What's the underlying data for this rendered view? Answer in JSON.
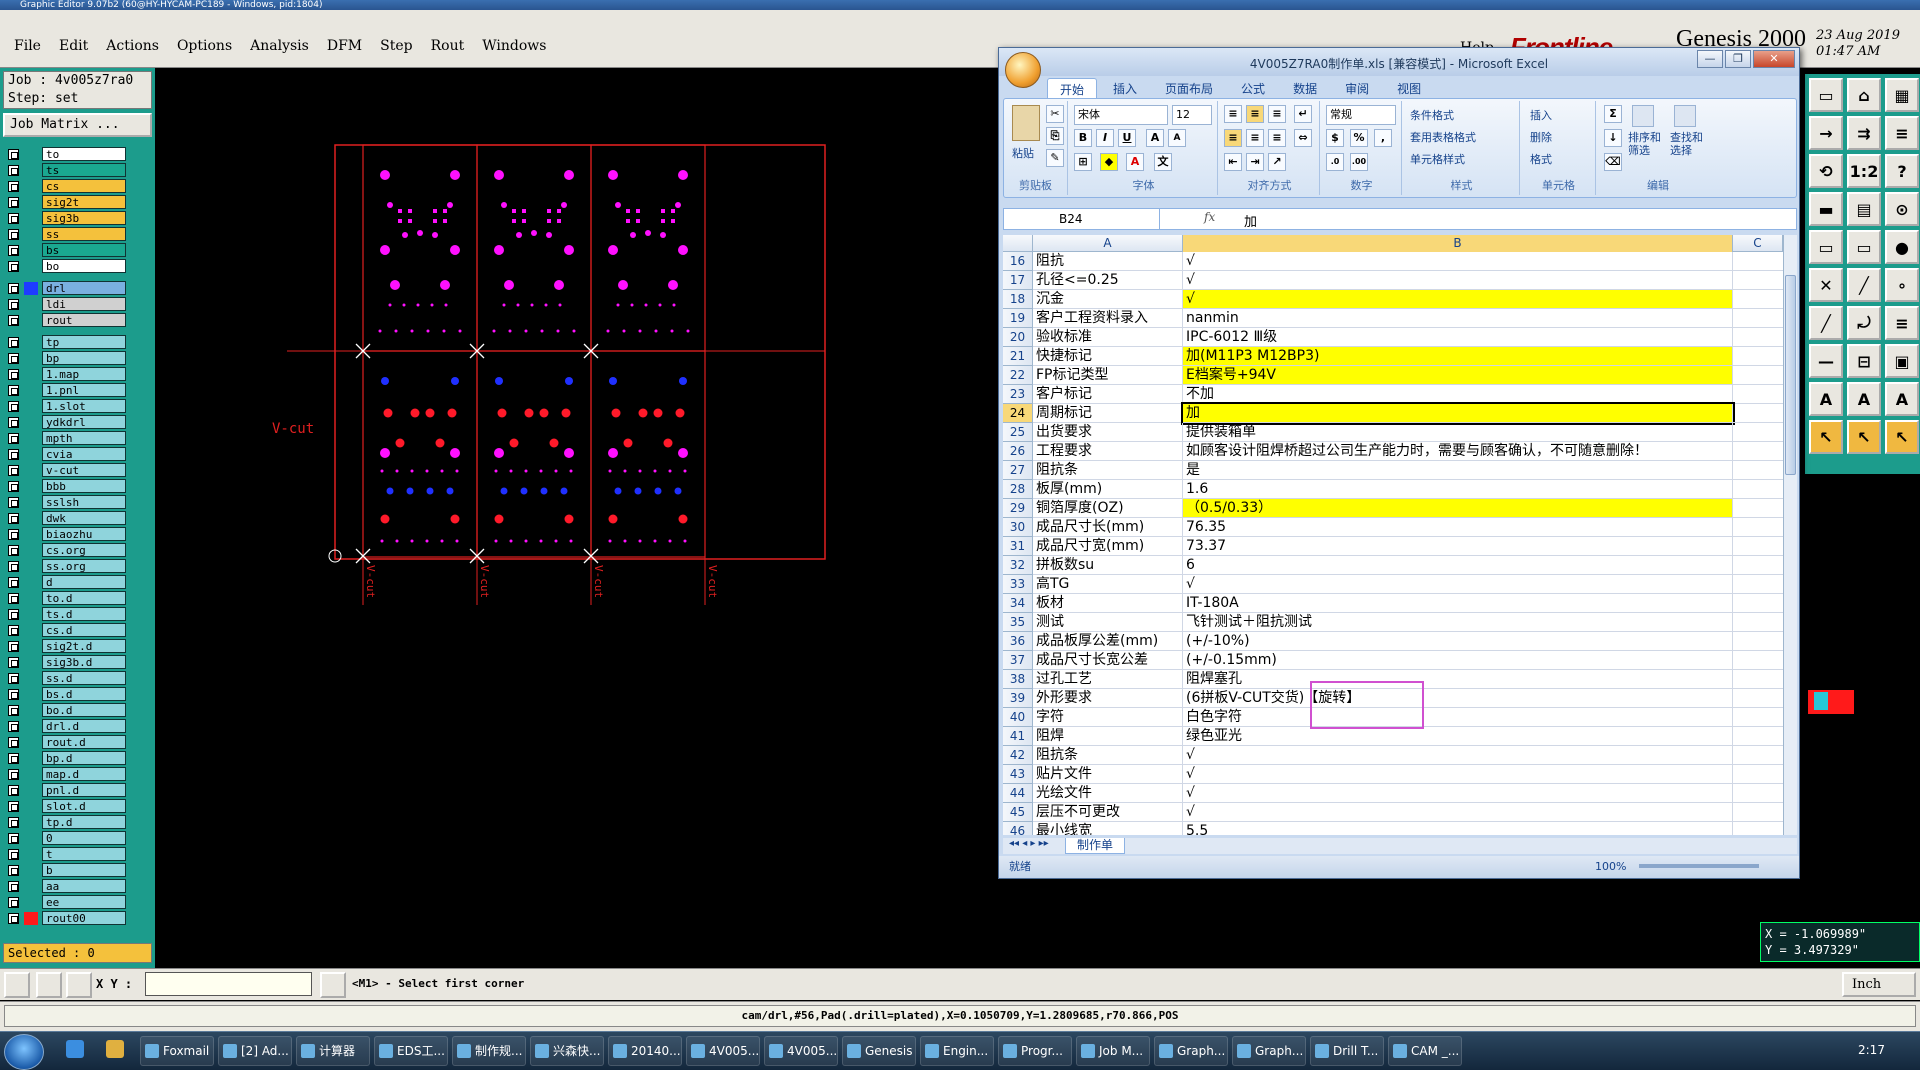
{
  "genesis": {
    "titlebar": "Graphic Editor 9.07b2 (60@HY-HYCAM-PC189 - Windows, pid:1804)",
    "menu": [
      "File",
      "Edit",
      "Actions",
      "Options",
      "Analysis",
      "DFM",
      "Step",
      "Rout",
      "Windows"
    ],
    "help": "Help",
    "brand_logo": "Frontline",
    "brand_product": "Genesis 2000",
    "date": "23 Aug 2019",
    "time": "01:47 AM",
    "job_line": "Job : 4v005z7ra0",
    "step_line": "Step: set",
    "job_matrix": "Job Matrix ...",
    "selected": "Selected : 0",
    "xy_label": "X Y :",
    "prompt": "<M1> - Select first corner",
    "unit": "Inch",
    "status_info": "cam/drl,#56,Pad(.drill=plated),X=0.1050709,Y=1.2809685,r70.866,POS",
    "coord_x": "X = -1.069989\"",
    "coord_y": "Y =  3.497329\"",
    "vcut_label": "V-cut",
    "layers_group1": [
      {
        "name": "to",
        "color": "#ffffff"
      },
      {
        "name": "ts",
        "color": "#1aa890"
      },
      {
        "name": "cs",
        "color": "#f4c13c"
      },
      {
        "name": "sig2t",
        "color": "#f4c13c"
      },
      {
        "name": "sig3b",
        "color": "#f4c13c"
      },
      {
        "name": "ss",
        "color": "#f4c13c"
      },
      {
        "name": "bs",
        "color": "#1aa890"
      },
      {
        "name": "bo",
        "color": "#ffffff"
      }
    ],
    "layers_group2": [
      {
        "name": "drl",
        "color": "#7ab0e0",
        "swatch": "#1e3cff"
      },
      {
        "name": "ldi",
        "color": "#d0d0d0"
      },
      {
        "name": "rout",
        "color": "#d0d0d0"
      }
    ],
    "layers_group3": [
      "tp",
      "bp",
      "1.map",
      "1.pnl",
      "1.slot",
      "ydkdrl",
      "mpth",
      "cvia",
      "v-cut",
      "bbb",
      "sslsh",
      "dwk",
      "biaozhu",
      "cs.org",
      "ss.org",
      "d",
      "to.d",
      "ts.d",
      "cs.d",
      "sig2t.d",
      "sig3b.d",
      "ss.d",
      "bs.d",
      "bo.d",
      "drl.d",
      "rout.d",
      "bp.d",
      "map.d",
      "pnl.d",
      "slot.d",
      "tp.d",
      "0",
      "t",
      "b",
      "aa",
      "ee",
      "rout00"
    ]
  },
  "excel": {
    "title": "4V005Z7RA0制作单.xls [兼容模式] - Microsoft Excel",
    "tabs": [
      "开始",
      "插入",
      "页面布局",
      "公式",
      "数据",
      "审阅",
      "视图"
    ],
    "groups": [
      "剪贴板",
      "字体",
      "对齐方式",
      "数字",
      "样式",
      "单元格",
      "编辑"
    ],
    "paste": "粘贴",
    "font_name": "宋体",
    "font_size": "12",
    "number_format": "常规",
    "style_items": [
      "条件格式",
      "套用表格格式",
      "单元格样式"
    ],
    "cell_items": [
      "插入",
      "删除",
      "格式"
    ],
    "edit_items": [
      "排序和筛选",
      "查找和选择"
    ],
    "name_box": "B24",
    "formula_value": "加",
    "columns": [
      "A",
      "B",
      "C"
    ],
    "rows": [
      {
        "n": "16",
        "a": "阻抗",
        "b": "√",
        "hl": false
      },
      {
        "n": "17",
        "a": "孔径<=0.25",
        "b": "√",
        "hl": false
      },
      {
        "n": "18",
        "a": "沉金",
        "b": "√",
        "hl": true
      },
      {
        "n": "19",
        "a": "客户工程资料录入",
        "b": "nanmin",
        "hl": false
      },
      {
        "n": "20",
        "a": "验收标准",
        "b": "IPC-6012 Ⅲ级",
        "hl": false
      },
      {
        "n": "21",
        "a": "快捷标记",
        "b": "加(M11P3 M12BP3)",
        "hl": true
      },
      {
        "n": "22",
        "a": "FP标记类型",
        "b": "E档案号+94V",
        "hl": true
      },
      {
        "n": "23",
        "a": "客户标记",
        "b": "不加",
        "hl": false
      },
      {
        "n": "24",
        "a": "周期标记",
        "b": "加",
        "hl": true,
        "sel": true
      },
      {
        "n": "25",
        "a": "出货要求",
        "b": "提供装箱单",
        "hl": false
      },
      {
        "n": "26",
        "a": "工程要求",
        "b": "如顾客设计阻焊桥超过公司生产能力时，需要与顾客确认，不可随意删除！",
        "hl": false
      },
      {
        "n": "27",
        "a": "阻抗条",
        "b": "是",
        "hl": false
      },
      {
        "n": "28",
        "a": "板厚(mm)",
        "b": "1.6",
        "hl": false
      },
      {
        "n": "29",
        "a": "铜箔厚度(OZ)",
        "b": "（0.5/0.33）",
        "hl": true
      },
      {
        "n": "30",
        "a": "成品尺寸长(mm)",
        "b": "76.35",
        "hl": false
      },
      {
        "n": "31",
        "a": "成品尺寸宽(mm)",
        "b": "73.37",
        "hl": false
      },
      {
        "n": "32",
        "a": "拼板数su",
        "b": "6",
        "hl": false
      },
      {
        "n": "33",
        "a": "高TG",
        "b": "√",
        "hl": false
      },
      {
        "n": "34",
        "a": "板材",
        "b": "IT-180A",
        "hl": false
      },
      {
        "n": "35",
        "a": "测试",
        "b": "飞针测试＋阻抗测试",
        "hl": false
      },
      {
        "n": "36",
        "a": "成品板厚公差(mm)",
        "b": "(+/-10%)",
        "hl": false
      },
      {
        "n": "37",
        "a": "成品尺寸长宽公差",
        "b": "(+/-0.15mm)",
        "hl": false
      },
      {
        "n": "38",
        "a": "过孔工艺",
        "b": "阻焊塞孔",
        "hl": false
      },
      {
        "n": "39",
        "a": "外形要求",
        "b": "(6拼板V-CUT交货)【旋转】",
        "hl": false
      },
      {
        "n": "40",
        "a": "字符",
        "b": "白色字符",
        "hl": false
      },
      {
        "n": "41",
        "a": "阻焊",
        "b": "绿色亚光",
        "hl": false
      },
      {
        "n": "42",
        "a": "阻抗条",
        "b": "√",
        "hl": false
      },
      {
        "n": "43",
        "a": "贴片文件",
        "b": "√",
        "hl": false
      },
      {
        "n": "44",
        "a": "光绘文件",
        "b": "√",
        "hl": false
      },
      {
        "n": "45",
        "a": "层压不可更改",
        "b": "√",
        "hl": false
      },
      {
        "n": "46",
        "a": "最小线宽",
        "b": "5.5",
        "hl": false
      }
    ],
    "sheet_tab": "制作单",
    "status": "就绪",
    "zoom": "100%"
  },
  "taskbar": {
    "items": [
      "Foxmail",
      "[2] Ad...",
      "计算器",
      "EDS工...",
      "制作规...",
      "兴森快...",
      "20140...",
      "4V005...",
      "4V005...",
      "Genesis",
      "Engin...",
      "Progr...",
      "Job M...",
      "Graph...",
      "Graph...",
      "Drill T...",
      "CAM _..."
    ],
    "clock": "2:17"
  }
}
